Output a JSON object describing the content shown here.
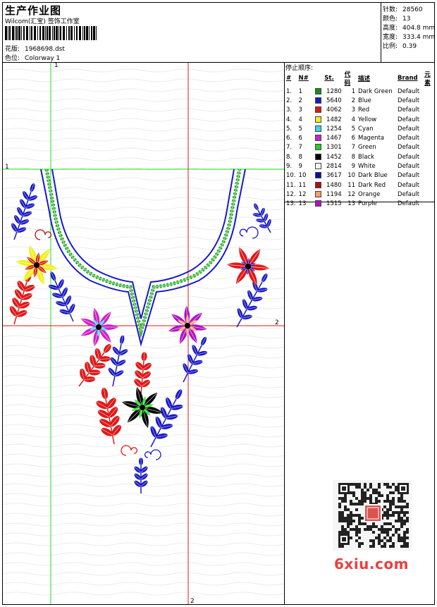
{
  "header": {
    "title": "生产作业图",
    "subtitle": "Wilcom(汇宝) 签饰工作室",
    "design_label": "花版:",
    "design_value": "1968698.dst",
    "color_label": "色位:",
    "color_value": "Colorway 1"
  },
  "info": [
    {
      "label": "针数:",
      "value": "28560"
    },
    {
      "label": "颜色:",
      "value": "13"
    },
    {
      "label": "高度:",
      "value": "404.8 mm"
    },
    {
      "label": "宽度:",
      "value": "333.4 mm"
    },
    {
      "label": "比例:",
      "value": "0.39"
    }
  ],
  "stops": {
    "title": "停止顺序:",
    "headers": [
      "#",
      "N#",
      "St.",
      "代码",
      "描述",
      "Brand",
      "元素"
    ],
    "rows": [
      {
        "idx": "1.",
        "n": "1",
        "color": "#1a8a1a",
        "st": "1280",
        "code": "1",
        "desc": "Dark Green",
        "brand": "Default"
      },
      {
        "idx": "2.",
        "n": "2",
        "color": "#1818c8",
        "st": "5640",
        "code": "2",
        "desc": "Blue",
        "brand": "Default"
      },
      {
        "idx": "3.",
        "n": "3",
        "color": "#e01818",
        "st": "4062",
        "code": "3",
        "desc": "Red",
        "brand": "Default"
      },
      {
        "idx": "4.",
        "n": "4",
        "color": "#f0f020",
        "st": "1482",
        "code": "4",
        "desc": "Yellow",
        "brand": "Default"
      },
      {
        "idx": "5.",
        "n": "5",
        "color": "#30d8e8",
        "st": "1254",
        "code": "5",
        "desc": "Cyan",
        "brand": "Default"
      },
      {
        "idx": "6.",
        "n": "6",
        "color": "#d020c8",
        "st": "1467",
        "code": "6",
        "desc": "Magenta",
        "brand": "Default"
      },
      {
        "idx": "7.",
        "n": "7",
        "color": "#20d020",
        "st": "1301",
        "code": "7",
        "desc": "Green",
        "brand": "Default"
      },
      {
        "idx": "8.",
        "n": "8",
        "color": "#000000",
        "st": "1452",
        "code": "8",
        "desc": "Black",
        "brand": "Default"
      },
      {
        "idx": "9.",
        "n": "9",
        "color": "#f4f4f4",
        "st": "2814",
        "code": "9",
        "desc": "White",
        "brand": "Default"
      },
      {
        "idx": "10.",
        "n": "10",
        "color": "#1010a0",
        "st": "3617",
        "code": "10",
        "desc": "Dark Blue",
        "brand": "Default"
      },
      {
        "idx": "11.",
        "n": "11",
        "color": "#b01010",
        "st": "1480",
        "code": "11",
        "desc": "Dark Red",
        "brand": "Default"
      },
      {
        "idx": "12.",
        "n": "12",
        "color": "#f4a070",
        "st": "1194",
        "code": "12",
        "desc": "Orange",
        "brand": "Default"
      },
      {
        "idx": "13.",
        "n": "13",
        "color": "#b010c8",
        "st": "1515",
        "code": "13",
        "desc": "Purple",
        "brand": "Default"
      }
    ]
  },
  "guides": {
    "v1": "1",
    "h1": "1",
    "v2": "2",
    "h2": "2"
  },
  "watermark": {
    "logo_text": "6xiu.com"
  },
  "icons": {
    "qr": "qr-code-icon",
    "stamp": "seal-stamp-icon"
  }
}
